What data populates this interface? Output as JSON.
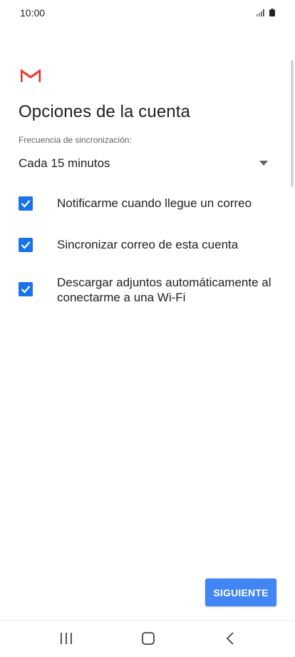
{
  "status_bar": {
    "time": "10:00",
    "icons": [
      "signal-icon",
      "battery-icon"
    ]
  },
  "app": {
    "logo": "gmail-logo",
    "brand_color": "#d93025"
  },
  "page": {
    "title": "Opciones de la cuenta"
  },
  "sync": {
    "label": "Frecuencia de sincronización:",
    "selected_value": "Cada 15 minutos",
    "icon": "dropdown-arrow-icon"
  },
  "options": [
    {
      "label_lines": [
        "Notificarme cuando llegue un correo"
      ],
      "checked": true
    },
    {
      "label_lines": [
        "Sincronizar correo de esta cuenta"
      ],
      "checked": true
    },
    {
      "label_lines": [
        "Descargar adjuntos automáticamente al",
        "conectarme a una Wi-Fi"
      ],
      "checked": true
    }
  ],
  "actions": {
    "next_label": "SIGUIENTE",
    "accent": "#4285f4"
  },
  "colors": {
    "checkbox": "#1a73e8"
  },
  "nav": {
    "icons": [
      "recent-apps-icon",
      "home-icon",
      "back-icon"
    ]
  }
}
